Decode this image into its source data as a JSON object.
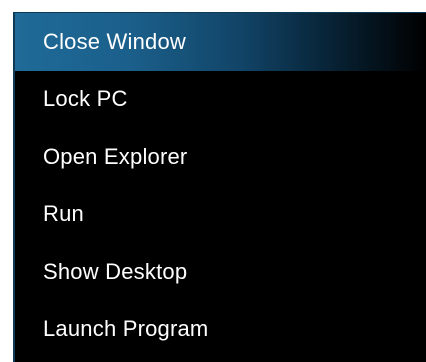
{
  "menu": {
    "items": [
      {
        "label": "Close Window",
        "selected": true
      },
      {
        "label": "Lock PC",
        "selected": false
      },
      {
        "label": "Open Explorer",
        "selected": false
      },
      {
        "label": "Run",
        "selected": false
      },
      {
        "label": "Show Desktop",
        "selected": false
      },
      {
        "label": "Launch Program",
        "selected": false
      }
    ]
  },
  "colors": {
    "menu_background": "#000000",
    "selection_start": "#1f6a98",
    "selection_end": "#000000",
    "text": "#ffffff",
    "border": "#0f3a55"
  }
}
